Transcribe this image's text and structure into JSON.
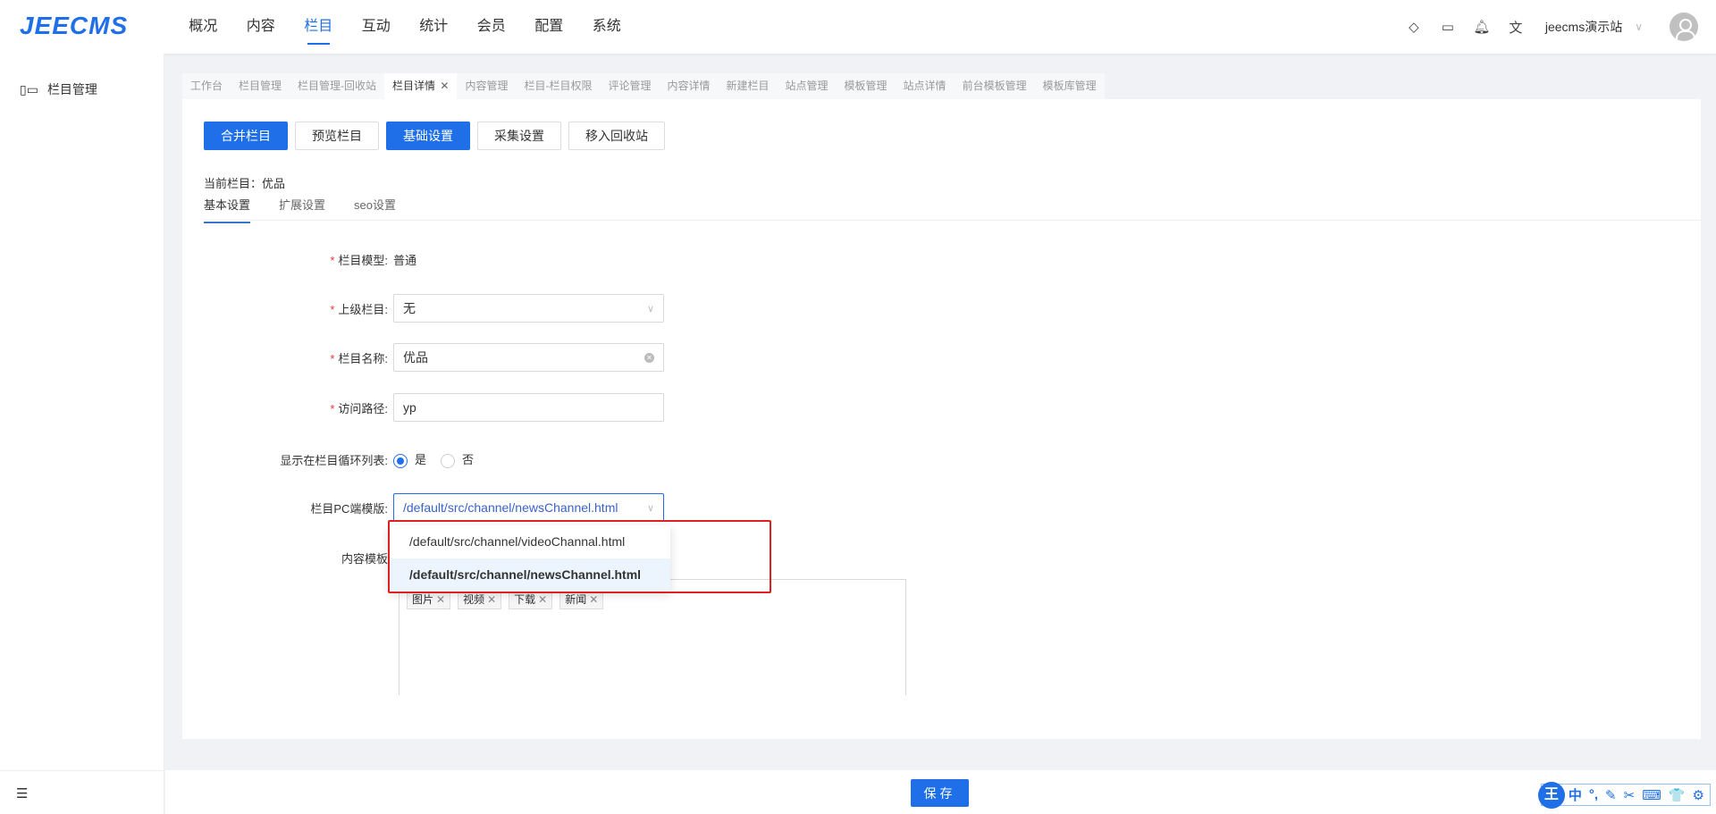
{
  "header": {
    "logo": "JEECMS",
    "nav": [
      "概况",
      "内容",
      "栏目",
      "互动",
      "统计",
      "会员",
      "配置",
      "系统"
    ],
    "active_nav": 2,
    "site": "jeecms演示站"
  },
  "sidebar": {
    "items": [
      {
        "label": "栏目管理"
      }
    ]
  },
  "tabs": [
    "工作台",
    "栏目管理",
    "栏目管理-回收站",
    "栏目详情",
    "内容管理",
    "栏目-栏目权限",
    "评论管理",
    "内容详情",
    "新建栏目",
    "站点管理",
    "模板管理",
    "站点详情",
    "前台模板管理",
    "模板库管理"
  ],
  "active_tab": 3,
  "actions": [
    "合并栏目",
    "预览栏目",
    "基础设置",
    "采集设置",
    "移入回收站"
  ],
  "current": "当前栏目：优品",
  "subtabs": [
    "基本设置",
    "扩展设置",
    "seo设置"
  ],
  "form": {
    "model_label": "栏目模型:",
    "model_value": "普通",
    "parent_label": "上级栏目:",
    "parent_value": "无",
    "name_label": "栏目名称:",
    "name_value": "优品",
    "path_label": "访问路径:",
    "path_value": "yp",
    "show_label": "显示在栏目循环列表:",
    "show_yes": "是",
    "show_no": "否",
    "pc_tpl_label": "栏目PC端模版:",
    "pc_tpl_value": "/default/src/channel/newsChannel.html",
    "pc_tpl_options": [
      "/default/src/channel/videoChannal.html",
      "/default/src/channel/newsChannel.html"
    ],
    "content_tpl_label": "内容模板",
    "content_tags": [
      "图片",
      "视频",
      "下载",
      "新闻"
    ]
  },
  "footer": {
    "save": "保存"
  },
  "ime": {
    "logo": "王",
    "items": [
      "中",
      "°,",
      "✎",
      "✂",
      "⌨",
      "👕",
      "⚙"
    ]
  }
}
